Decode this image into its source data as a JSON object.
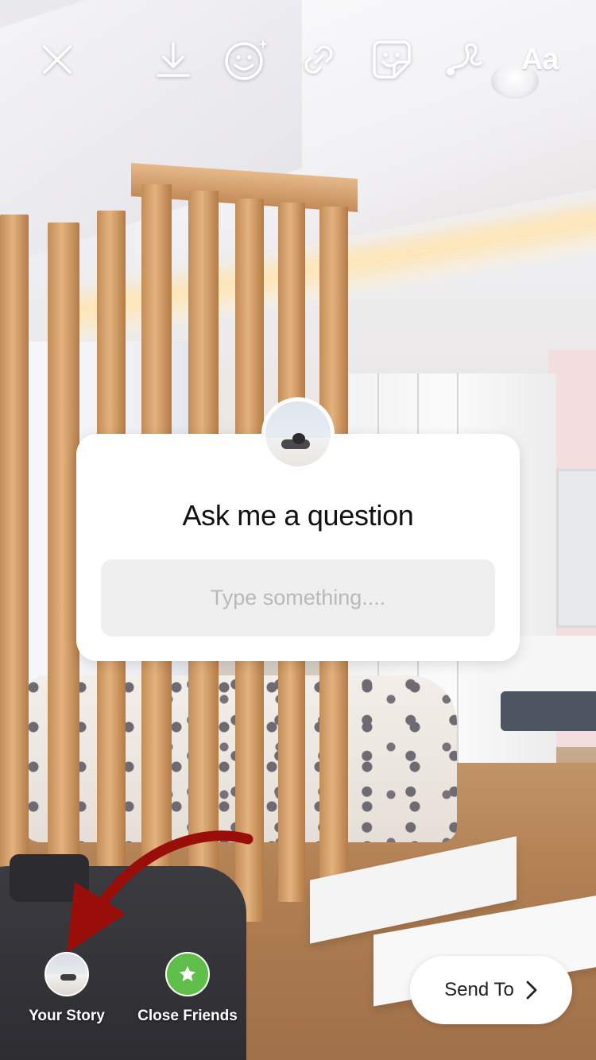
{
  "toolbar": {
    "close_icon": "close-icon",
    "download_icon": "download-icon",
    "face_effects_icon": "face-effects-icon",
    "link_icon": "link-icon",
    "sticker_icon": "sticker-icon",
    "draw_icon": "draw-icon",
    "text_label": "Aa"
  },
  "sticker": {
    "title": "Ask me a question",
    "input_placeholder": "Type something....",
    "input_value": ""
  },
  "share": {
    "your_story_label": "Your Story",
    "close_friends_label": "Close Friends",
    "close_friends_icon": "star-icon",
    "send_to_label": "Send To",
    "send_to_icon": "chevron-right-icon"
  },
  "colors": {
    "close_friends_green": "#5fbf4a",
    "annotation_red": "#9a0e0a"
  }
}
